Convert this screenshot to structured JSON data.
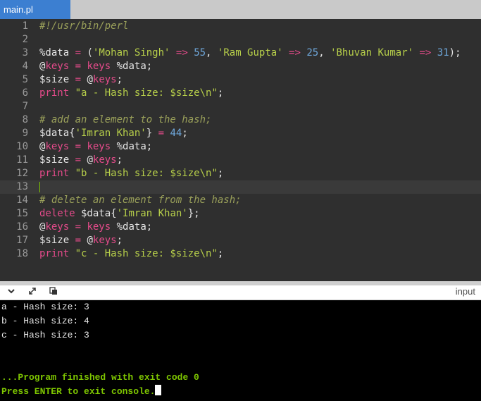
{
  "tab": {
    "label": "main.pl"
  },
  "editor": {
    "active_line": 13,
    "lines": [
      {
        "num": "1",
        "tokens": [
          {
            "t": "#!/usr/bin/perl",
            "c": "comment"
          }
        ]
      },
      {
        "num": "2",
        "tokens": []
      },
      {
        "num": "3",
        "tokens": [
          {
            "t": "%data",
            "c": "var"
          },
          {
            "t": " = ",
            "c": "op"
          },
          {
            "t": "(",
            "c": "punct"
          },
          {
            "t": "'Mohan Singh'",
            "c": "str"
          },
          {
            "t": " => ",
            "c": "op"
          },
          {
            "t": "55",
            "c": "num"
          },
          {
            "t": ", ",
            "c": "punct"
          },
          {
            "t": "'Ram Gupta'",
            "c": "str"
          },
          {
            "t": " => ",
            "c": "op"
          },
          {
            "t": "25",
            "c": "num"
          },
          {
            "t": ", ",
            "c": "punct"
          },
          {
            "t": "'Bhuvan Kumar'",
            "c": "str"
          },
          {
            "t": " => ",
            "c": "op"
          },
          {
            "t": "31",
            "c": "num"
          },
          {
            "t": ");",
            "c": "punct"
          }
        ]
      },
      {
        "num": "4",
        "tokens": [
          {
            "t": "@",
            "c": "var"
          },
          {
            "t": "keys",
            "c": "kw"
          },
          {
            "t": " = ",
            "c": "op"
          },
          {
            "t": "keys",
            "c": "kw"
          },
          {
            "t": " %data;",
            "c": "var"
          }
        ]
      },
      {
        "num": "5",
        "tokens": [
          {
            "t": "$size",
            "c": "var"
          },
          {
            "t": " = ",
            "c": "op"
          },
          {
            "t": "@",
            "c": "var"
          },
          {
            "t": "keys",
            "c": "kw"
          },
          {
            "t": ";",
            "c": "punct"
          }
        ]
      },
      {
        "num": "6",
        "tokens": [
          {
            "t": "print",
            "c": "kw"
          },
          {
            "t": " ",
            "c": "punct"
          },
          {
            "t": "\"a - Hash size: $size\\n\"",
            "c": "str"
          },
          {
            "t": ";",
            "c": "punct"
          }
        ]
      },
      {
        "num": "7",
        "tokens": []
      },
      {
        "num": "8",
        "tokens": [
          {
            "t": "# add an element to the hash;",
            "c": "comment"
          }
        ]
      },
      {
        "num": "9",
        "tokens": [
          {
            "t": "$data{",
            "c": "var"
          },
          {
            "t": "'Imran Khan'",
            "c": "str"
          },
          {
            "t": "}",
            "c": "var"
          },
          {
            "t": " = ",
            "c": "op"
          },
          {
            "t": "44",
            "c": "num"
          },
          {
            "t": ";",
            "c": "punct"
          }
        ]
      },
      {
        "num": "10",
        "tokens": [
          {
            "t": "@",
            "c": "var"
          },
          {
            "t": "keys",
            "c": "kw"
          },
          {
            "t": " = ",
            "c": "op"
          },
          {
            "t": "keys",
            "c": "kw"
          },
          {
            "t": " %data;",
            "c": "var"
          }
        ]
      },
      {
        "num": "11",
        "tokens": [
          {
            "t": "$size",
            "c": "var"
          },
          {
            "t": " = ",
            "c": "op"
          },
          {
            "t": "@",
            "c": "var"
          },
          {
            "t": "keys",
            "c": "kw"
          },
          {
            "t": ";",
            "c": "punct"
          }
        ]
      },
      {
        "num": "12",
        "tokens": [
          {
            "t": "print",
            "c": "kw"
          },
          {
            "t": " ",
            "c": "punct"
          },
          {
            "t": "\"b - Hash size: $size\\n\"",
            "c": "str"
          },
          {
            "t": ";",
            "c": "punct"
          }
        ]
      },
      {
        "num": "13",
        "tokens": []
      },
      {
        "num": "14",
        "tokens": [
          {
            "t": "# delete an element from the hash;",
            "c": "comment"
          }
        ]
      },
      {
        "num": "15",
        "tokens": [
          {
            "t": "delete",
            "c": "kw"
          },
          {
            "t": " $data{",
            "c": "var"
          },
          {
            "t": "'Imran Khan'",
            "c": "str"
          },
          {
            "t": "};",
            "c": "var"
          }
        ]
      },
      {
        "num": "16",
        "tokens": [
          {
            "t": "@",
            "c": "var"
          },
          {
            "t": "keys",
            "c": "kw"
          },
          {
            "t": " = ",
            "c": "op"
          },
          {
            "t": "keys",
            "c": "kw"
          },
          {
            "t": " %data;",
            "c": "var"
          }
        ]
      },
      {
        "num": "17",
        "tokens": [
          {
            "t": "$size",
            "c": "var"
          },
          {
            "t": " = ",
            "c": "op"
          },
          {
            "t": "@",
            "c": "var"
          },
          {
            "t": "keys",
            "c": "kw"
          },
          {
            "t": ";",
            "c": "punct"
          }
        ]
      },
      {
        "num": "18",
        "tokens": [
          {
            "t": "print",
            "c": "kw"
          },
          {
            "t": " ",
            "c": "punct"
          },
          {
            "t": "\"c - Hash size: $size\\n\"",
            "c": "str"
          },
          {
            "t": ";",
            "c": "punct"
          }
        ]
      }
    ]
  },
  "toolbar": {
    "collapse_icon": "chevron-down-icon",
    "expand_icon": "expand-arrows-icon",
    "copy_icon": "copy-icon",
    "input_label": "input"
  },
  "console": {
    "output_lines": [
      "a - Hash size: 3",
      "b - Hash size: 4",
      "c - Hash size: 3"
    ],
    "finished_message": "...Program finished with exit code 0",
    "exit_prompt": "Press ENTER to exit console."
  }
}
